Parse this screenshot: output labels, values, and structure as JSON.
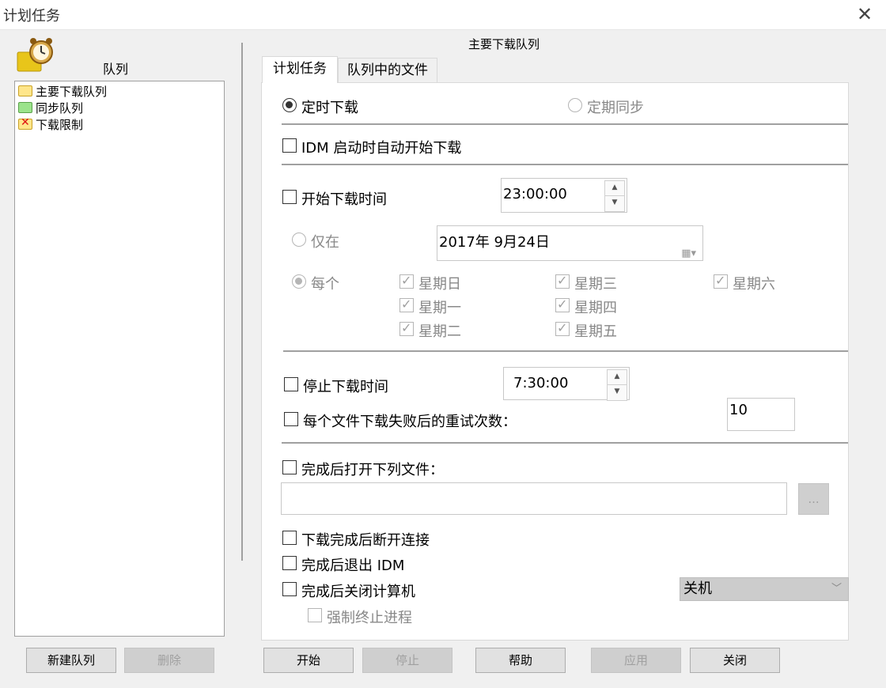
{
  "window": {
    "title": "计划任务",
    "close_icon": "close-icon"
  },
  "queue_panel": {
    "caption": "队列",
    "queue_name_header": "主要下载队列",
    "items": [
      {
        "label": "主要下载队列",
        "icon": "folder-icon"
      },
      {
        "label": "同步队列",
        "icon": "folder-sync-icon"
      },
      {
        "label": "下载限制",
        "icon": "folder-limit-icon"
      }
    ],
    "new_queue_button": "新建队列",
    "delete_button": "删除"
  },
  "tabs": [
    {
      "label": "计划任务",
      "active": true
    },
    {
      "label": "队列中的文件",
      "active": false
    }
  ],
  "schedule": {
    "mode_one_time": "定时下载",
    "mode_periodic": "定期同步",
    "auto_start_on_idm": "IDM 启动时自动开始下载",
    "start_time_label": "开始下载时间",
    "start_time_value": "23:00:00",
    "only_on_label": "仅在",
    "only_on_date": "2017年  9月24日",
    "every_label": "每个",
    "weekdays": {
      "sun": "星期日",
      "mon": "星期一",
      "tue": "星期二",
      "wed": "星期三",
      "thu": "星期四",
      "fri": "星期五",
      "sat": "星期六"
    },
    "stop_time_label": "停止下载时间",
    "stop_time_value": "7:30:00",
    "retry_label": "每个文件下载失败后的重试次数：",
    "retry_value": "10",
    "open_file_label": "完成后打开下列文件：",
    "open_file_value": "",
    "browse_button": "...",
    "hang_up_label": "下载完成后断开连接",
    "exit_idm_label": "完成后退出 IDM",
    "shutdown_label": "完成后关闭计算机",
    "shutdown_option": "关机",
    "force_terminate_label": "强制终止进程"
  },
  "footer": {
    "start": "开始",
    "stop": "停止",
    "help": "帮助",
    "apply": "应用",
    "close": "关闭"
  }
}
